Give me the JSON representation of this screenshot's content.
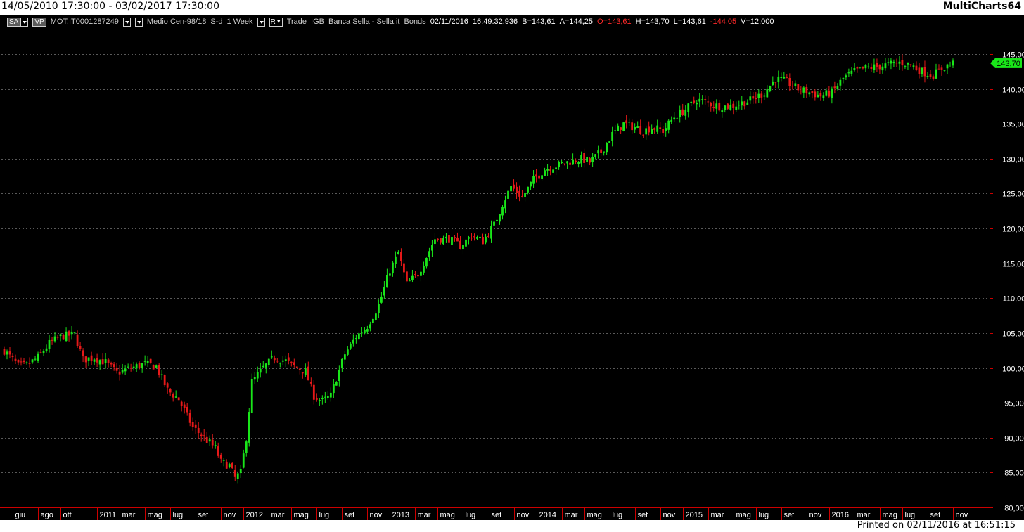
{
  "window": {
    "date_range": "14/05/2010 17:30:00 - 03/02/2017 17:30:00",
    "app_name": "MultiCharts64"
  },
  "toolbar": {
    "sa_label": "SA",
    "vp_label": "VP",
    "symbol": "MOT.IT0001287249",
    "description": "Medio Cen-98/18",
    "sd_label": "S-d",
    "interval": "1 Week",
    "r_label": "R",
    "data_type": "Trade",
    "source": "IGB",
    "broker": "Banca Sella - Sella.it",
    "category": "Bonds",
    "date": "02/11/2016",
    "time": "16:49:32.936",
    "bid": "B=143,61",
    "ask": "A=144,25",
    "open": "O=143,61",
    "high": "H=143,70",
    "low": "L=143,61",
    "change": "-144,05",
    "volume": "V=12.000"
  },
  "footer": {
    "printed": "Printed on 02/11/2016 at 16:51:15"
  },
  "colors": {
    "background": "#000000",
    "up_candle": "#19e619",
    "down_candle": "#e61919",
    "axis": "#cc0000",
    "grid": "#5a5a5a",
    "last_price_tag": "#19e619"
  },
  "chart_data": {
    "type": "candlestick",
    "title": "",
    "xlabel": "",
    "ylabel": "",
    "ylim": [
      80,
      147
    ],
    "y_ticks": [
      "145,00",
      "140,00",
      "135,00",
      "130,00",
      "125,00",
      "120,00",
      "115,00",
      "110,00",
      "105,00",
      "100,00",
      "95,00",
      "90,00",
      "85,00",
      "80,00"
    ],
    "y_tick_values": [
      145,
      140,
      135,
      130,
      125,
      120,
      115,
      110,
      105,
      100,
      95,
      90,
      85,
      80
    ],
    "x_ticks": [
      {
        "label": "giu",
        "week": 3
      },
      {
        "label": "ago",
        "week": 12
      },
      {
        "label": "ott",
        "week": 20
      },
      {
        "label": "2011",
        "week": 33
      },
      {
        "label": "mar",
        "week": 41
      },
      {
        "label": "mag",
        "week": 50
      },
      {
        "label": "lug",
        "week": 59
      },
      {
        "label": "set",
        "week": 68
      },
      {
        "label": "nov",
        "week": 77
      },
      {
        "label": "2012",
        "week": 85
      },
      {
        "label": "mar",
        "week": 94
      },
      {
        "label": "mag",
        "week": 102
      },
      {
        "label": "lug",
        "week": 111
      },
      {
        "label": "set",
        "week": 120
      },
      {
        "label": "nov",
        "week": 129
      },
      {
        "label": "2013",
        "week": 137
      },
      {
        "label": "mar",
        "week": 146
      },
      {
        "label": "mag",
        "week": 154
      },
      {
        "label": "lug",
        "week": 163
      },
      {
        "label": "set",
        "week": 172
      },
      {
        "label": "nov",
        "week": 181
      },
      {
        "label": "2014",
        "week": 189
      },
      {
        "label": "mar",
        "week": 198
      },
      {
        "label": "mag",
        "week": 206
      },
      {
        "label": "lug",
        "week": 215
      },
      {
        "label": "set",
        "week": 224
      },
      {
        "label": "nov",
        "week": 233
      },
      {
        "label": "2015",
        "week": 241
      },
      {
        "label": "mar",
        "week": 250
      },
      {
        "label": "mag",
        "week": 259
      },
      {
        "label": "lug",
        "week": 267
      },
      {
        "label": "set",
        "week": 276
      },
      {
        "label": "nov",
        "week": 285
      },
      {
        "label": "2016",
        "week": 293
      },
      {
        "label": "mar",
        "week": 302
      },
      {
        "label": "mag",
        "week": 311
      },
      {
        "label": "lug",
        "week": 319
      },
      {
        "label": "set",
        "week": 328
      },
      {
        "label": "nov",
        "week": 337
      }
    ],
    "last_price": "143,70",
    "last_price_value": 143.7,
    "weeks": 338,
    "close_anchors": [
      [
        0,
        102.5
      ],
      [
        5,
        100.3
      ],
      [
        8,
        100.4
      ],
      [
        12,
        101.5
      ],
      [
        16,
        103.5
      ],
      [
        20,
        104.5
      ],
      [
        25,
        104.8
      ],
      [
        28,
        101.2
      ],
      [
        32,
        101.5
      ],
      [
        36,
        100.8
      ],
      [
        40,
        99.3
      ],
      [
        45,
        100.0
      ],
      [
        50,
        100.6
      ],
      [
        54,
        100.2
      ],
      [
        58,
        96.8
      ],
      [
        62,
        95.5
      ],
      [
        67,
        91.5
      ],
      [
        71,
        90.0
      ],
      [
        75,
        88.5
      ],
      [
        77,
        86.5
      ],
      [
        80,
        86.0
      ],
      [
        82,
        84.2
      ],
      [
        84,
        85.0
      ],
      [
        86,
        90.0
      ],
      [
        88,
        98.0
      ],
      [
        92,
        100.0
      ],
      [
        96,
        101.5
      ],
      [
        100,
        101.0
      ],
      [
        104,
        100.0
      ],
      [
        107,
        99.5
      ],
      [
        110,
        96.0
      ],
      [
        113,
        95.2
      ],
      [
        116,
        96.0
      ],
      [
        118,
        98.5
      ],
      [
        121,
        102.0
      ],
      [
        125,
        104.5
      ],
      [
        129,
        106.0
      ],
      [
        133,
        109.0
      ],
      [
        137,
        114.0
      ],
      [
        140,
        116.5
      ],
      [
        143,
        112.0
      ],
      [
        147,
        113.5
      ],
      [
        150,
        116.0
      ],
      [
        153,
        118.5
      ],
      [
        158,
        118.5
      ],
      [
        162,
        117.5
      ],
      [
        166,
        119.0
      ],
      [
        170,
        118.2
      ],
      [
        174,
        120.5
      ],
      [
        177,
        123.5
      ],
      [
        180,
        126.0
      ],
      [
        184,
        124.5
      ],
      [
        188,
        127.0
      ],
      [
        192,
        128.5
      ],
      [
        196,
        129.0
      ],
      [
        200,
        129.5
      ],
      [
        205,
        130.0
      ],
      [
        208,
        129.5
      ],
      [
        212,
        131.0
      ],
      [
        216,
        133.5
      ],
      [
        220,
        135.0
      ],
      [
        224,
        134.5
      ],
      [
        227,
        134.0
      ],
      [
        230,
        134.5
      ],
      [
        234,
        134.0
      ],
      [
        238,
        136.0
      ],
      [
        242,
        137.0
      ],
      [
        246,
        138.5
      ],
      [
        250,
        138.0
      ],
      [
        254,
        137.5
      ],
      [
        258,
        137.5
      ],
      [
        262,
        138.0
      ],
      [
        266,
        138.5
      ],
      [
        270,
        139.5
      ],
      [
        274,
        141.5
      ],
      [
        278,
        141.0
      ],
      [
        282,
        140.0
      ],
      [
        286,
        139.5
      ],
      [
        290,
        139.0
      ],
      [
        294,
        139.5
      ],
      [
        298,
        141.5
      ],
      [
        302,
        142.5
      ],
      [
        306,
        143.0
      ],
      [
        310,
        143.2
      ],
      [
        314,
        143.5
      ],
      [
        318,
        143.8
      ],
      [
        322,
        143.5
      ],
      [
        326,
        142.5
      ],
      [
        330,
        142.0
      ],
      [
        334,
        143.2
      ],
      [
        337,
        143.7
      ]
    ]
  }
}
